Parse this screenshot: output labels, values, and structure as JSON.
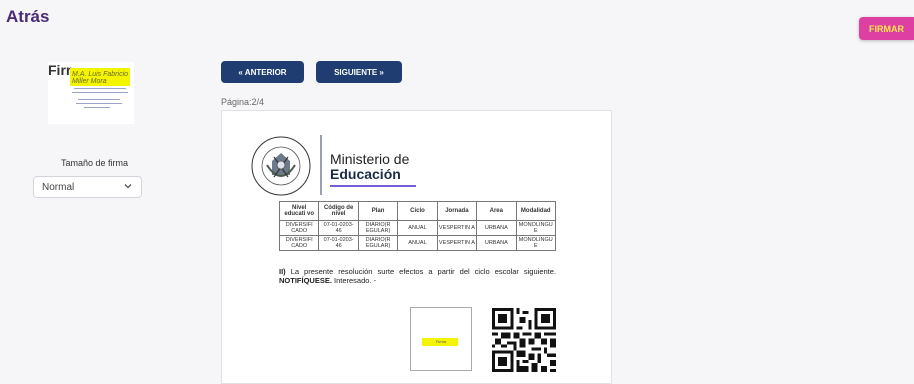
{
  "header": {
    "back_label": "Atrás",
    "sign_button_label": "FIRMAR"
  },
  "sidebar": {
    "signature_preview": {
      "label_fragment": "Firr",
      "handwriting": "M.A. Luis Fabricio Miller Mora"
    },
    "size_label": "Tamaño de firma",
    "size_select": {
      "value": "Normal"
    }
  },
  "navigation": {
    "prev_label": "« ANTERIOR",
    "next_label": "SIGUIENTE »",
    "page_indicator": "Página:2/4"
  },
  "document": {
    "ministry_line1": "Ministerio de",
    "ministry_line2": "Educación",
    "table": {
      "headers": [
        "Nivel educati vo",
        "Código de nivel",
        "Plan",
        "Ciclo",
        "Jornada",
        "Area",
        "Modalidad"
      ],
      "rows": [
        [
          "DIVERSIFI CADO",
          "07-01-0203- 46",
          "DIARIO(R EGULAR)",
          "ANUAL",
          "VESPERTIN A",
          "URBANA",
          "MONOLINGU E"
        ],
        [
          "DIVERSIFI CADO",
          "07-01-0203- 46",
          "DIARIO(R EGULAR)",
          "ANUAL",
          "VESPERTIN A",
          "URBANA",
          "MONOLINGU E"
        ]
      ]
    },
    "paragraph": {
      "prefix": "II)",
      "text": " La presente resolución surte efectos a partir del ciclo escolar siguiente. ",
      "emphasis": "NOTIFÍQUESE.",
      "suffix": " Interesado. -"
    },
    "signature_box_label": "Firma"
  },
  "colors": {
    "brand_purple": "#4a2a78",
    "nav_button": "#1f3d70",
    "sign_button": "#de3fa2",
    "highlight": "#f4f400"
  }
}
